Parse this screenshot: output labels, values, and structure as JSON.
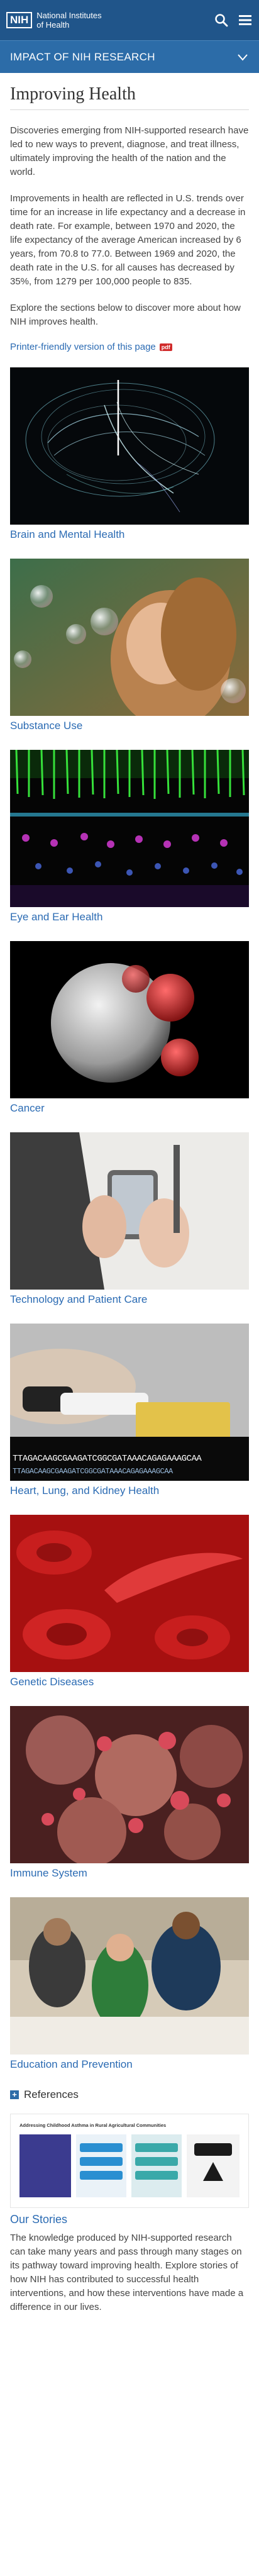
{
  "header": {
    "logo_mark": "NIH",
    "logo_line1": "National Institutes",
    "logo_line2": "of Health",
    "icons": [
      "search-icon",
      "menu-icon"
    ]
  },
  "section_nav": {
    "label": "IMPACT OF NIH RESEARCH",
    "icon": "chevron-down-icon"
  },
  "page": {
    "title": "Improving Health",
    "paragraphs": [
      "Discoveries emerging from NIH-supported research have led to new ways to prevent, diagnose, and treat illness, ultimately improving the health of the nation and the world.",
      "Improvements in health are reflected in U.S. trends over time for an increase in life expectancy and a decrease in death rate. For example, between 1970 and 2020, the life expectancy of the average American increased by 6 years, from 70.8 to 77.0. Between 1969 and 2020, the death rate in the U.S. for all causes has decreased by 35%, from 1279 per 100,000 people to 835.",
      "Explore the sections below to discover more about how NIH improves health."
    ],
    "printer_link": "Printer-friendly version of this page",
    "pdf_badge": "pdf"
  },
  "tiles": [
    {
      "label": "Brain and Mental Health"
    },
    {
      "label": "Substance Use"
    },
    {
      "label": "Eye and Ear Health"
    },
    {
      "label": "Cancer"
    },
    {
      "label": "Technology and Patient Care"
    },
    {
      "label": "Heart, Lung, and Kidney Health"
    },
    {
      "label": "Genetic Diseases"
    },
    {
      "label": "Immune System"
    },
    {
      "label": "Education and Prevention"
    }
  ],
  "references": {
    "label": "References",
    "icon": "plus-icon"
  },
  "stories": {
    "title": "Our Stories",
    "text": "The knowledge produced by NIH-supported research can take many years and pass through many stages on its pathway toward improving health. Explore stories of how NIH has contributed to successful health interventions, and how these interventions have made a difference in our lives.",
    "thumb_title": "Addressing Childhood Asthma in Rural Agricultural Communities",
    "dna_text": "TTAGACAAGCGAAGATCGGCGATAAACAGAGAAAGCAA"
  },
  "colors": {
    "header_bg": "#20558a",
    "section_bg": "#2c6ca8",
    "link": "#2b6bb3",
    "pdf": "#d12b2b"
  }
}
